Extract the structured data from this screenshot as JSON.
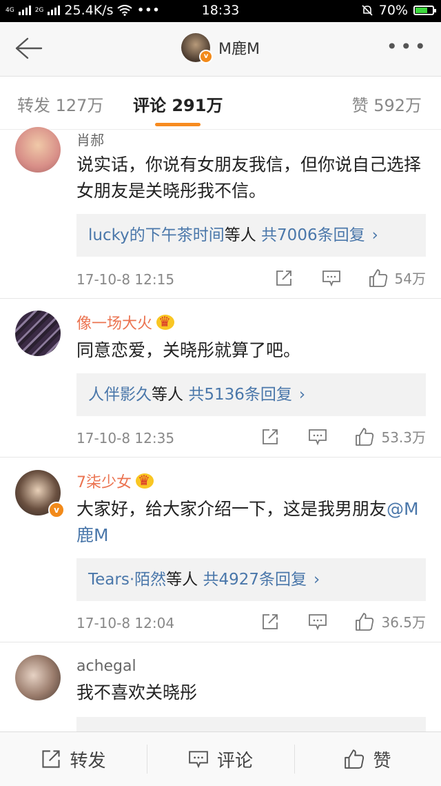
{
  "status_bar": {
    "network": "4G",
    "network2": "2G",
    "speed": "25.4K/s",
    "dots": "•••",
    "time": "18:33",
    "battery_text": "70%",
    "battery_level": 0.7
  },
  "header": {
    "title": "M鹿M",
    "verified_badge": "v",
    "more_icon": "more-dots-icon"
  },
  "tabs": [
    {
      "label": "转发 127万",
      "active": false
    },
    {
      "label": "评论 291万",
      "active": true
    },
    {
      "label": "赞 592万",
      "active": false
    }
  ],
  "comments": [
    {
      "name": "肖郝",
      "vip": false,
      "text": "说实话，你说有女朋友我信，但你说自己选择女朋友是关晓彤我不信。",
      "reply_who": "lucky的下午茶时间",
      "reply_mid": "等人",
      "reply_count": "共7006条回复",
      "reply_chevron": "›",
      "time": "17-10-8 12:15",
      "likes": "54万"
    },
    {
      "name": "像一场大火",
      "vip": true,
      "text": "同意恋爱，关晓彤就算了吧。",
      "reply_who": "人伴影久",
      "reply_mid": "等人",
      "reply_count": "共5136条回复",
      "reply_chevron": "›",
      "time": "17-10-8 12:35",
      "likes": "53.3万"
    },
    {
      "name": "7柒少女",
      "vip": true,
      "verified_badge": "v",
      "text_pre": "大家好，给大家介绍一下，这是我男朋友",
      "mention": "@M鹿M",
      "reply_who": "Tears·陌然",
      "reply_mid": "等人",
      "reply_count": "共4927条回复",
      "reply_chevron": "›",
      "time": "17-10-8 12:04",
      "likes": "36.5万"
    },
    {
      "name": "achegal",
      "vip": false,
      "text": "我不喜欢关晓彤"
    }
  ],
  "bottom_bar": {
    "repost": "转发",
    "comment": "评论",
    "like": "赞"
  },
  "colors": {
    "accent": "#f78b1f",
    "link": "#4a77aa",
    "vip_name": "#eb7350"
  }
}
